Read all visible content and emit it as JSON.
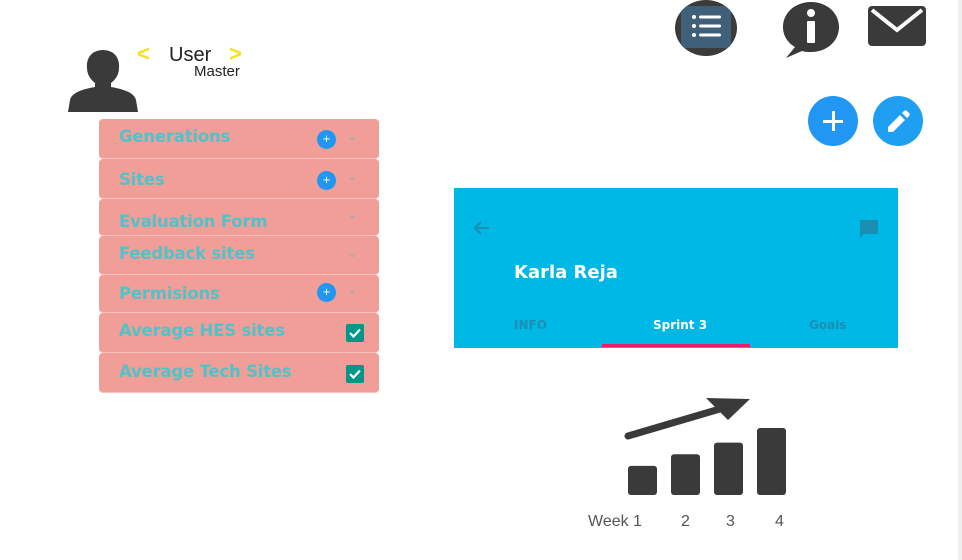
{
  "header": {
    "user_label": "User",
    "user_sub": "Master",
    "chevron_left": "<",
    "chevron_right": ">"
  },
  "menu": {
    "items": [
      {
        "label": "Generations",
        "plus": "+",
        "caret": "⌄"
      },
      {
        "label": "Sites",
        "plus": "+",
        "caret": "⌄"
      },
      {
        "label": "Evaluation Form",
        "caret": "⌄"
      },
      {
        "label": "Feedback sites",
        "caret": "⌄"
      },
      {
        "label": "Permisions",
        "plus": "+",
        "caret": "⌄"
      },
      {
        "label": "Average HES sites",
        "checked": true
      },
      {
        "label": "Average Tech Sites",
        "checked": true
      }
    ]
  },
  "card": {
    "name": "Karla Reja",
    "tabs": [
      "INFO",
      "Sprint 3",
      "Goals"
    ],
    "active_tab": "Sprint 3"
  },
  "chart_data": {
    "type": "bar",
    "categories": [
      "Week 1",
      "2",
      "3",
      "4"
    ],
    "values": [
      1,
      1.4,
      1.8,
      2.3
    ]
  },
  "colors": {
    "menu_bg": "#f29e98",
    "menu_text": "#4fc3c8",
    "fab_blue": "#2196f3",
    "card_bg": "#00b8e6",
    "tab_indicator": "#e91e63",
    "checkbox": "#009688",
    "chevron": "#f5e21a"
  }
}
